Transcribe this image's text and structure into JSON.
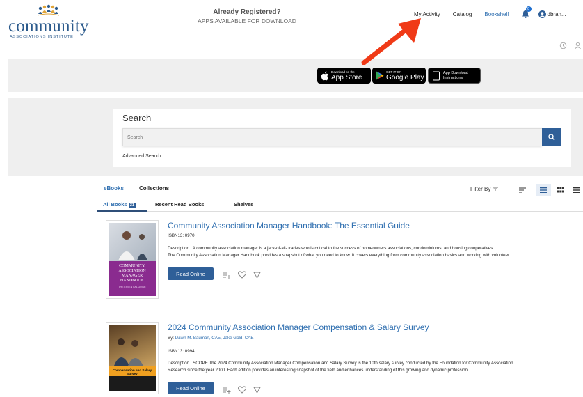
{
  "brand": {
    "word": "community",
    "sub": "ASSOCIATIONS INSTITUTE"
  },
  "nav": {
    "my_activity": "My Activity",
    "catalog": "Catalog",
    "bookshelf": "Bookshelf",
    "notifications_count": "0",
    "user_name": "dbran..."
  },
  "banner": {
    "title": "Already Registered?",
    "subtitle": "APPS AVAILABLE FOR DOWNLOAD",
    "app_store_small": "Download on the",
    "app_store_big": "App Store",
    "google_small": "GET IT ON",
    "google_big": "Google Play",
    "instructions_line1": "App Download",
    "instructions_line2": "Instructions"
  },
  "search": {
    "title": "Search",
    "placeholder": "Search",
    "advanced": "Advanced Search"
  },
  "tabs": {
    "ebooks": "eBooks",
    "collections": "Collections",
    "filter_by": "Filter By"
  },
  "subtabs": {
    "all_books": "All Books",
    "all_books_count": "31",
    "recent": "Recent Read Books",
    "shelves": "Shelves"
  },
  "books": [
    {
      "title": "Community Association Manager Handbook: The Essential Guide",
      "isbn": "ISBN13: 0970",
      "desc_line1": "Description : A community association manager is a jack-of-all- trades who is critical to the success of homeowners associations, condominiums, and housing cooperatives.",
      "desc_line2": "The Community Association Manager Handbook provides a snapshot of what you need to know. It covers everything from community association basics and working with volunteer...",
      "read_label": "Read Online",
      "cover_text": "COMMUNITY ASSOCIATION MANAGER HANDBOOK",
      "cover_sub": "THE ESSENTIAL GUIDE"
    },
    {
      "title": "2024 Community Association Manager Compensation & Salary Survey",
      "by_label": "By:",
      "authors": "Dawn M. Bauman, CAE, Jake Gold, CAE",
      "isbn": "ISBN13: 0994",
      "desc_line1": "Description : SCOPE The 2024 Community Association Manager Compensation and Salary Survey is the 10th salary survey conducted by the Foundation for Community Association",
      "desc_line2": "Research since the year 2000. Each edition provides an interesting snapshot of the field and enhances understanding of this growing and dynamic profession.",
      "read_label": "Read Online",
      "cover_text": "Compensation and Salary Survey"
    }
  ],
  "colors": {
    "accent": "#2f6fb0",
    "button": "#2f5f98",
    "arrow": "#f03a17"
  }
}
